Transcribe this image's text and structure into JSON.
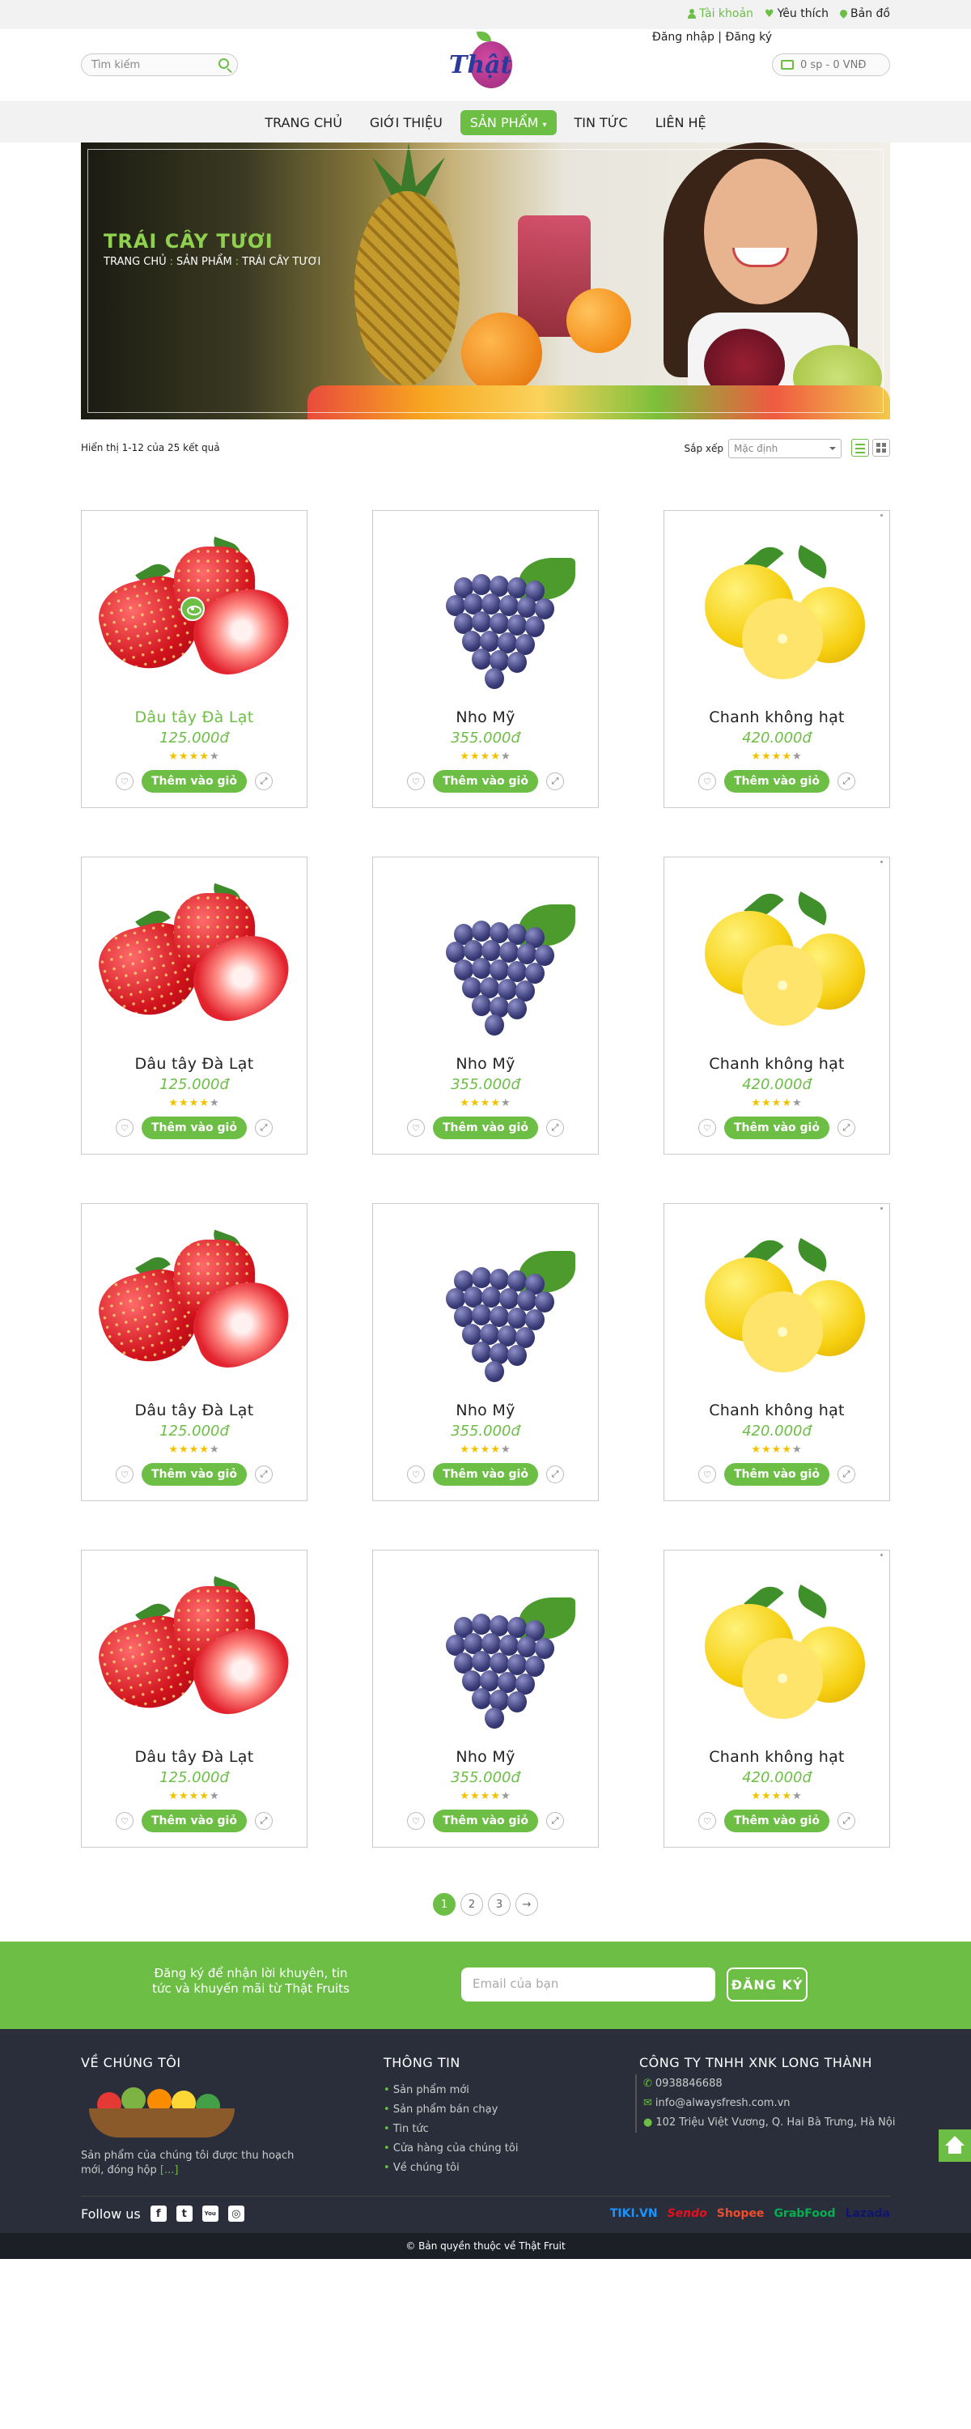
{
  "topbar": {
    "account": "Tài khoản",
    "wishlist": "Yêu thích",
    "map": "Bản đồ"
  },
  "header": {
    "search_placeholder": "Tìm kiếm",
    "logo_text": "Thật",
    "login": "Đăng nhập | Đăng ký",
    "cart": "0 sp - 0 VNĐ"
  },
  "nav": {
    "items": [
      "TRANG CHỦ",
      "GIỚI THIỆU",
      "SẢN PHẨM",
      "TIN TỨC",
      "LIÊN HỆ"
    ],
    "active_index": 2
  },
  "banner": {
    "title": "TRÁI CÂY TƯƠI",
    "crumbs": [
      "TRANG CHỦ",
      "SẢN PHẨM",
      "TRÁI CÂY TƯƠI"
    ]
  },
  "toolbar": {
    "result_count": "Hiển thị 1-12 của 25 kết quả",
    "sort_label": "Sắp xếp",
    "sort_value": "Mặc định"
  },
  "products": [
    {
      "name": "Dâu tây Đà Lạt",
      "price": "125.000đ",
      "rating": 4,
      "cta": "Thêm vào giỏ",
      "kind": "strawberry"
    },
    {
      "name": "Nho Mỹ",
      "price": "355.000đ",
      "rating": 4,
      "cta": "Thêm vào giỏ",
      "kind": "grape"
    },
    {
      "name": "Chanh không hạt",
      "price": "420.000đ",
      "rating": 4,
      "cta": "Thêm vào giỏ",
      "kind": "lemon"
    },
    {
      "name": "Dâu tây Đà Lạt",
      "price": "125.000đ",
      "rating": 4,
      "cta": "Thêm vào giỏ",
      "kind": "strawberry"
    },
    {
      "name": "Nho Mỹ",
      "price": "355.000đ",
      "rating": 4,
      "cta": "Thêm vào giỏ",
      "kind": "grape"
    },
    {
      "name": "Chanh không hạt",
      "price": "420.000đ",
      "rating": 4,
      "cta": "Thêm vào giỏ",
      "kind": "lemon"
    },
    {
      "name": "Dâu tây Đà Lạt",
      "price": "125.000đ",
      "rating": 4,
      "cta": "Thêm vào giỏ",
      "kind": "strawberry"
    },
    {
      "name": "Nho Mỹ",
      "price": "355.000đ",
      "rating": 4,
      "cta": "Thêm vào giỏ",
      "kind": "grape"
    },
    {
      "name": "Chanh không hạt",
      "price": "420.000đ",
      "rating": 4,
      "cta": "Thêm vào giỏ",
      "kind": "lemon"
    },
    {
      "name": "Dâu tây Đà Lạt",
      "price": "125.000đ",
      "rating": 4,
      "cta": "Thêm vào giỏ",
      "kind": "strawberry"
    },
    {
      "name": "Nho Mỹ",
      "price": "355.000đ",
      "rating": 4,
      "cta": "Thêm vào giỏ",
      "kind": "grape"
    },
    {
      "name": "Chanh không hạt",
      "price": "420.000đ",
      "rating": 4,
      "cta": "Thêm vào giỏ",
      "kind": "lemon"
    }
  ],
  "pagination": {
    "pages": [
      "1",
      "2",
      "3"
    ],
    "current": "1",
    "next": "→"
  },
  "newsletter": {
    "message": "Đăng ký để nhận lời khuyên, tin tức và khuyến mãi từ Thật Fruits",
    "email_placeholder": "Email của bạn",
    "button": "ĐĂNG KÝ"
  },
  "footer": {
    "about_title": "VỀ CHÚNG TÔI",
    "about_text": "Sản phẩm của chúng tôi được thu hoạch mới, đóng hộp",
    "about_more": "[...]",
    "info_title": "THÔNG TIN",
    "info_links": [
      "Sản phẩm mới",
      "Sản phẩm bán chạy",
      "Tin tức",
      "Cửa hàng của chúng tôi",
      "Về chúng tôi"
    ],
    "company_title": "CÔNG TY TNHH XNK LONG THÀNH",
    "phone": "0938846688",
    "email": "info@alwaysfresh.com.vn",
    "address": "102 Triệu Việt Vương, Q. Hai Bà Trưng, Hà Nội",
    "follow_label": "Follow us",
    "socials": [
      "f",
      "t",
      "You",
      "◎"
    ],
    "partners": [
      "TIKI.VN",
      "Sendo",
      "Shopee",
      "GrabFood",
      "Lazada"
    ],
    "copyright": "© Bản quyền thuộc về Thật Fruit"
  },
  "colors": {
    "accent": "#6cbe45",
    "footer_bg": "#2a2e3a",
    "star": "#f2c200"
  }
}
